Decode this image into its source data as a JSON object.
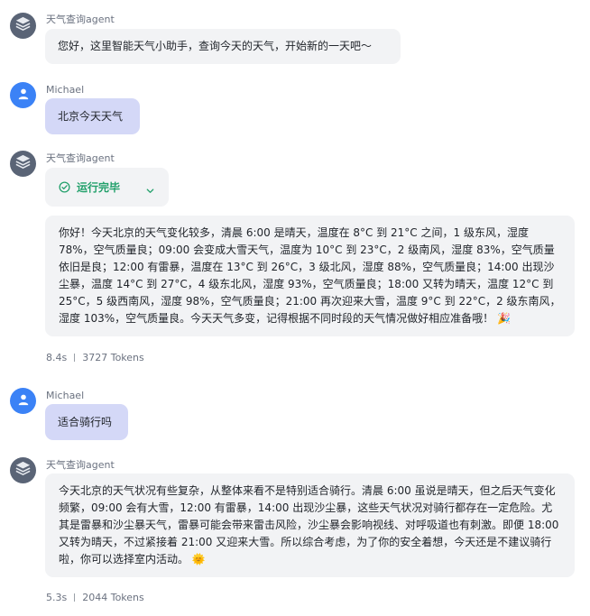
{
  "messages": [
    {
      "sender": "天气查询agent",
      "text": "您好，这里智能天气小助手，查询今天的天气，开始新的一天吧～"
    },
    {
      "sender": "Michael",
      "text": "北京今天天气"
    },
    {
      "sender": "天气查询agent",
      "status": "运行完毕",
      "text": "你好！今天北京的天气变化较多，清晨 6:00 是晴天，温度在 8°C 到 21°C 之间，1 级东风，湿度 78%，空气质量良；09:00 会变成大雪天气，温度为 10°C 到 23°C，2 级南风，湿度 83%，空气质量依旧是良；12:00 有雷暴，温度在 13°C 到 26°C，3 级北风，湿度 88%，空气质量良；14:00 出现沙尘暴，温度 14°C 到 27°C，4 级东北风，湿度 93%，空气质量良；18:00 又转为晴天，温度 12°C 到 25°C，5 级西南风，湿度 98%，空气质量良；21:00 再次迎来大雪，温度 9°C 到 22°C，2 级东南风，湿度 103%，空气质量良。今天天气多变，记得根据不同时段的天气情况做好相应准备哦！",
      "emoji": "🎉",
      "time": "8.4s",
      "tokens": "3727 Tokens"
    },
    {
      "sender": "Michael",
      "text": "适合骑行吗"
    },
    {
      "sender": "天气查询agent",
      "text": "今天北京的天气状况有些复杂，从整体来看不是特别适合骑行。清晨 6:00 虽说是晴天，但之后天气变化频繁，09:00 会有大雪，12:00 有雷暴，14:00 出现沙尘暴，这些天气状况对骑行都存在一定危险。尤其是雷暴和沙尘暴天气，雷暴可能会带来雷击风险，沙尘暴会影响视线、对呼吸道也有刺激。即便 18:00 又转为晴天，不过紧接着 21:00 又迎来大雪。所以综合考虑，为了你的安全着想，今天还是不建议骑行啦，你可以选择室内活动。",
      "emoji": "🌞",
      "time": "5.3s",
      "tokens": "2044 Tokens"
    }
  ],
  "icons": {
    "agent_avatar": "layers-stack-icon",
    "user_avatar": "user-icon",
    "status": "check-circle-icon",
    "expand": "chevron-down-icon"
  },
  "colors": {
    "agent_bubble": "#f2f3f5",
    "user_bubble": "#d4d8f7",
    "user_avatar": "#3b82f6",
    "agent_avatar": "#5a6476",
    "success": "#22a06b"
  }
}
